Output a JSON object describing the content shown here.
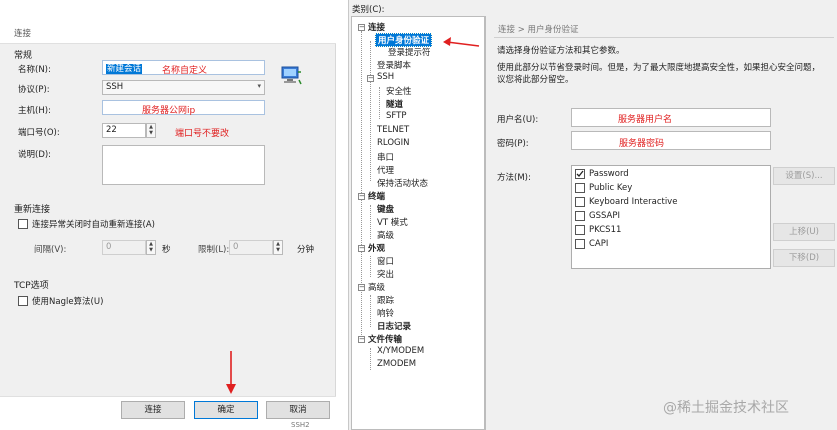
{
  "left": {
    "title": "连接",
    "general_section": "常规",
    "name_label": "名称(N):",
    "name_value": "新建会话",
    "name_note": "名称自定义",
    "protocol_label": "协议(P):",
    "protocol_value": "SSH",
    "host_label": "主机(H):",
    "host_note": "服务器公网ip",
    "port_label": "端口号(O):",
    "port_value": "22",
    "port_note": "端口号不要改",
    "desc_label": "说明(D):",
    "reconnect_section": "重新连接",
    "reconnect_checkbox": "连接异常关闭时自动重新连接(A)",
    "interval_label": "间隔(V):",
    "interval_value": "0",
    "interval_unit": "秒",
    "limit_label": "限制(L):",
    "limit_value": "0",
    "limit_unit": "分钟",
    "tcp_section": "TCP选项",
    "nagle_checkbox": "使用Nagle算法(U)",
    "connect_button": "连接",
    "ok_button": "确定",
    "cancel_button": "取消",
    "footer_fragment": "SSH2"
  },
  "right": {
    "category_label": "类别(C):",
    "tree": {
      "connection": "连接",
      "user_auth": "用户身份验证",
      "login_prompt": "登录提示符",
      "login_script": "登录脚本",
      "ssh": "SSH",
      "security": "安全性",
      "tunnel": "隧道",
      "sftp": "SFTP",
      "telnet": "TELNET",
      "rlogin": "RLOGIN",
      "serial": "串口",
      "proxy": "代理",
      "keepalive": "保持活动状态",
      "terminal": "终端",
      "keyboard": "键盘",
      "vt_mode": "VT 模式",
      "advanced1": "高级",
      "appearance": "外观",
      "window": "窗口",
      "highlight": "突出",
      "advanced2": "高级",
      "trace": "跟踪",
      "bell": "响铃",
      "log": "日志记录",
      "file_transfer": "文件传输",
      "xymodem": "X/YMODEM",
      "zmodem": "ZMODEM"
    },
    "breadcrumb": "连接 > 用户身份验证",
    "desc1": "请选择身份验证方法和其它参数。",
    "desc2": "使用此部分以节省登录时间。但是，为了最大限度地提高安全性，如果担心安全问题，",
    "desc3": "议您将此部分留空。",
    "username_label": "用户名(U):",
    "username_note": "服务器用户名",
    "password_label": "密码(P):",
    "password_note": "服务器密码",
    "method_label": "方法(M):",
    "methods": [
      "Password",
      "Public Key",
      "Keyboard Interactive",
      "GSSAPI",
      "PKCS11",
      "CAPI"
    ],
    "settings_button": "设置(S)...",
    "up_button": "上移(U)",
    "down_button": "下移(D)",
    "watermark": "@稀土掘金技术社区"
  },
  "colors": {
    "accent": "#0078d7",
    "annotation": "#e02020"
  }
}
